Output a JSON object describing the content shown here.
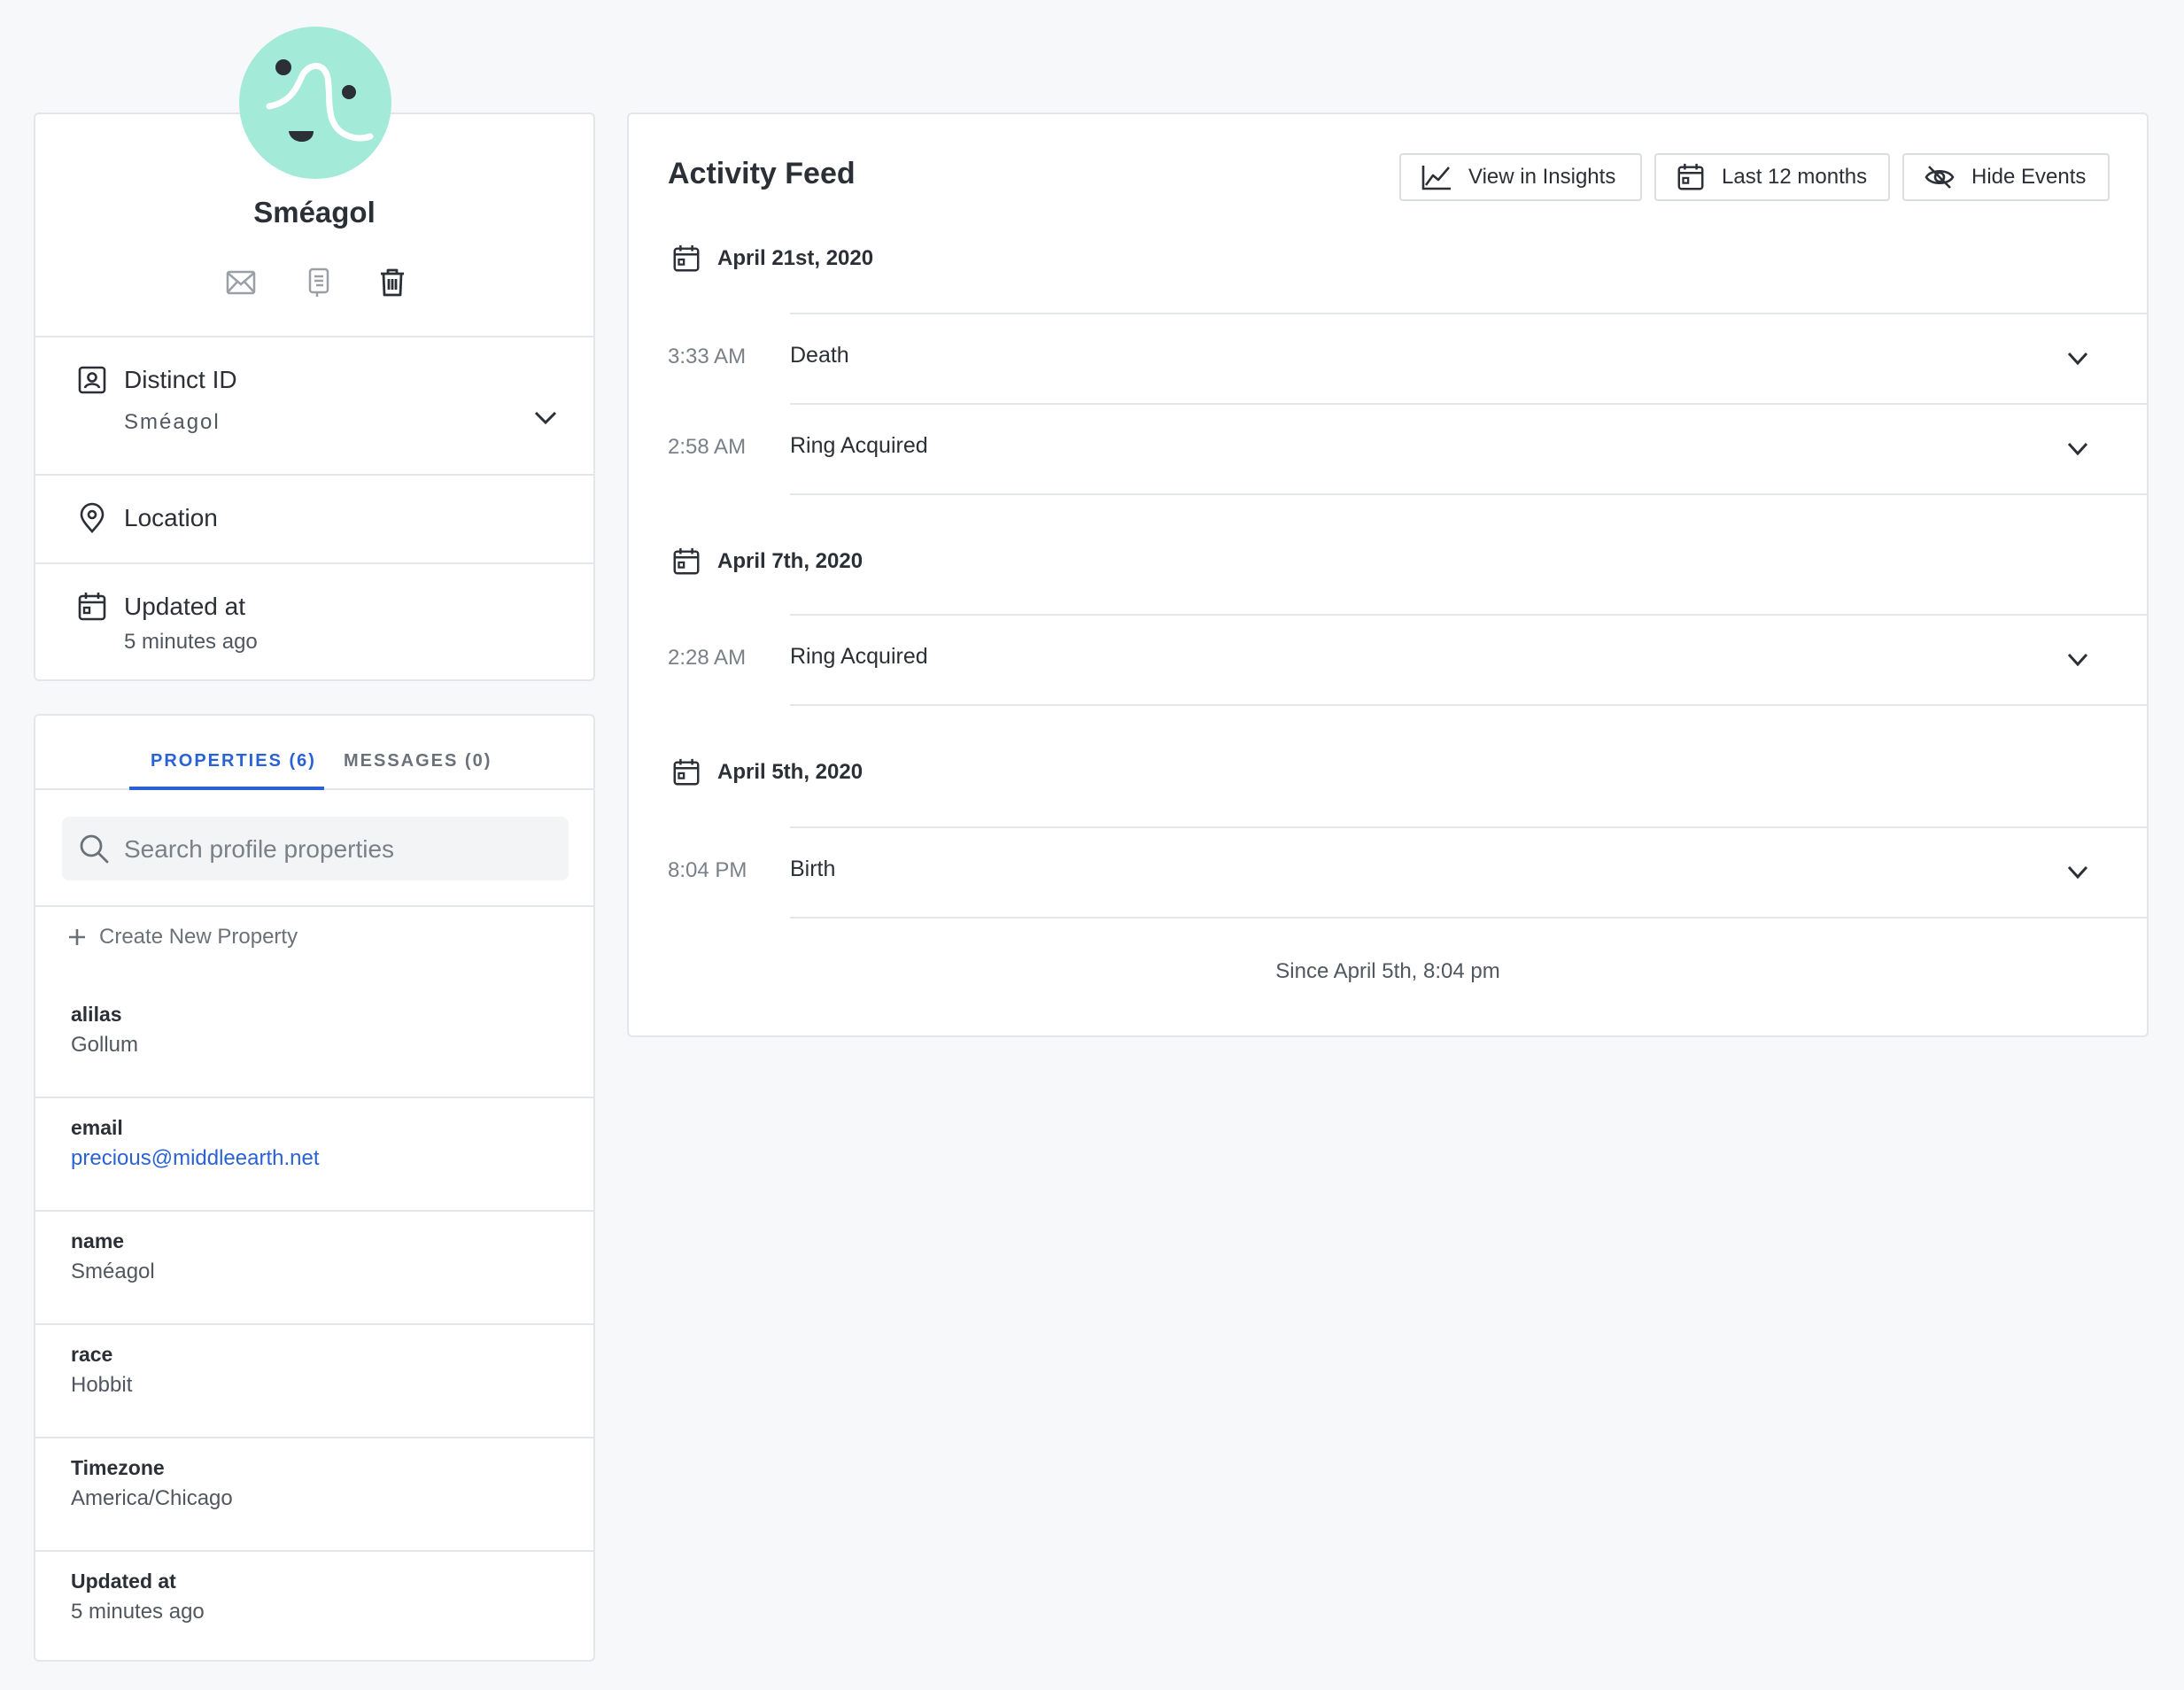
{
  "profile": {
    "name": "Sméagol",
    "actions": {
      "email_icon": "envelope-icon",
      "copy_icon": "copy-icon",
      "delete_icon": "trash-icon"
    },
    "distinct_id": {
      "label": "Distinct ID",
      "value": "Sméagol"
    },
    "location": {
      "label": "Location"
    },
    "updated_at": {
      "label": "Updated at",
      "value": "5 minutes ago"
    }
  },
  "tabs": [
    {
      "label": "PROPERTIES (6)",
      "active": true
    },
    {
      "label": "MESSAGES (0)",
      "active": false
    }
  ],
  "search": {
    "placeholder": "Search profile properties"
  },
  "create_property_label": "Create New Property",
  "properties": [
    {
      "key": "alilas",
      "value": "Gollum"
    },
    {
      "key": "email",
      "value": "precious@middleearth.net"
    },
    {
      "key": "name",
      "value": "Sméagol"
    },
    {
      "key": "race",
      "value": "Hobbit"
    },
    {
      "key": "Timezone",
      "value": "America/Chicago"
    },
    {
      "key": "Updated at",
      "value": "5 minutes ago"
    }
  ],
  "feed": {
    "title": "Activity Feed",
    "buttons": {
      "insights": "View in Insights",
      "range": "Last 12 months",
      "hide": "Hide Events"
    },
    "groups": [
      {
        "date": "April 21st, 2020",
        "events": [
          {
            "time": "3:33 AM",
            "name": "Death"
          },
          {
            "time": "2:58 AM",
            "name": "Ring Acquired"
          }
        ]
      },
      {
        "date": "April 7th, 2020",
        "events": [
          {
            "time": "2:28 AM",
            "name": "Ring Acquired"
          }
        ]
      },
      {
        "date": "April 5th, 2020",
        "events": [
          {
            "time": "8:04 PM",
            "name": "Birth"
          }
        ]
      }
    ],
    "since": "Since April 5th, 8:04 pm"
  },
  "colors": {
    "accent": "#2a62d6",
    "avatar_bg": "#a3ead8",
    "background": "#f7f8fa"
  }
}
